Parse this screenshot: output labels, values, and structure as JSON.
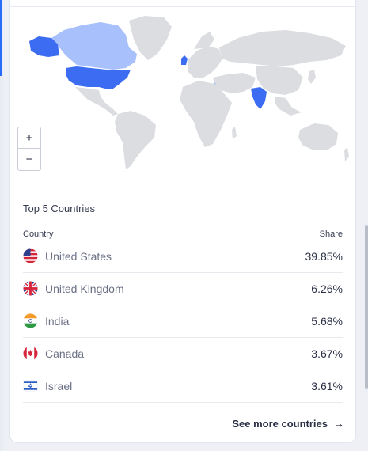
{
  "widget": {
    "title": "Top 5 Countries",
    "column_country": "Country",
    "column_share": "Share",
    "see_more_label": "See more countries",
    "see_more_icon": "arrow-right-icon"
  },
  "map": {
    "zoom_in_label": "+",
    "zoom_out_label": "−",
    "highlight_color_strong": "#3b6cf1",
    "highlight_color_light": "#a8c0fb",
    "land_color": "#dcdde1"
  },
  "countries": [
    {
      "name": "United States",
      "share": "39.85%",
      "flag_icon": "us-flag-icon"
    },
    {
      "name": "United Kingdom",
      "share": "6.26%",
      "flag_icon": "uk-flag-icon"
    },
    {
      "name": "India",
      "share": "5.68%",
      "flag_icon": "india-flag-icon"
    },
    {
      "name": "Canada",
      "share": "3.67%",
      "flag_icon": "canada-flag-icon"
    },
    {
      "name": "Israel",
      "share": "3.61%",
      "flag_icon": "israel-flag-icon"
    }
  ]
}
